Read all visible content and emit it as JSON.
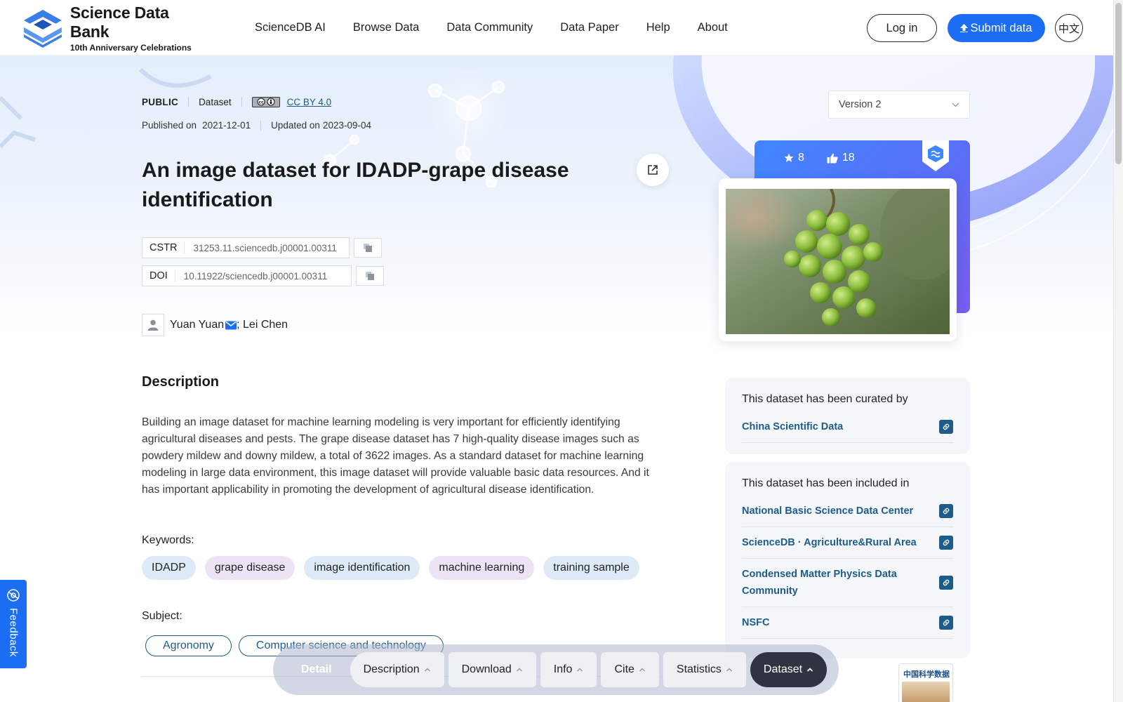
{
  "header": {
    "logo_title": "Science Data Bank",
    "logo_subtitle": "10th Anniversary Celebrations",
    "nav": [
      {
        "label": "ScienceDB AI"
      },
      {
        "label": "Browse Data"
      },
      {
        "label": "Data Community"
      },
      {
        "label": "Data Paper"
      },
      {
        "label": "Help"
      },
      {
        "label": "About"
      }
    ],
    "login_label": "Log in",
    "submit_label": "Submit data",
    "lang_label": "中文"
  },
  "meta": {
    "access": "PUBLIC",
    "type": "Dataset",
    "license": "CC BY 4.0",
    "published_label": "Published on",
    "published_date": "2021-12-01",
    "updated_label": "Updated on",
    "updated_date": "2023-09-04"
  },
  "dataset": {
    "title": "An image dataset for IDADP-grape disease identification",
    "cstr_label": "CSTR",
    "cstr_value": "31253.11.sciencedb.j00001.00311",
    "doi_label": "DOI",
    "doi_value": "10.11922/sciencedb.j00001.00311",
    "author1": "Yuan Yuan",
    "author_sep": "; ",
    "author2": "Lei Chen"
  },
  "description": {
    "heading": "Description",
    "text": "Building an image dataset for machine learning modeling is very important for efficiently identifying agricultural diseases and pests. The grape disease dataset has 7 high-quality disease images such as powdery mildew and downy mildew, a total of 3622 images. As a standard dataset for machine learning modeling in large data environment, this image dataset will provide valuable basic data resources. And it has important applicability in promoting the development of agricultural disease identification."
  },
  "keywords": {
    "label": "Keywords:",
    "items": [
      "IDADP",
      "grape disease",
      "image identification",
      "machine learning",
      "training sample"
    ]
  },
  "subject": {
    "label": "Subject:",
    "items": [
      "Agronomy",
      "Computer science and technology"
    ]
  },
  "sidebar": {
    "version": "Version 2",
    "stars": "8",
    "likes": "18",
    "curated_heading": "This dataset has been curated by",
    "curated": [
      {
        "label": "China Scientific Data"
      }
    ],
    "included_heading": "This dataset has been included in",
    "included": [
      {
        "label": "National Basic Science Data Center"
      },
      {
        "label": "ScienceDB · Agriculture&Rural Area"
      },
      {
        "label": "Condensed Matter Physics Data Community"
      },
      {
        "label": "NSFC"
      }
    ],
    "journal_thumb_text": "中国科学数据"
  },
  "feedback_label": "Feedback",
  "bottom_bar": {
    "detail": "Detail",
    "items": [
      {
        "label": "Description"
      },
      {
        "label": "Download"
      },
      {
        "label": "Info"
      },
      {
        "label": "Cite"
      },
      {
        "label": "Statistics"
      },
      {
        "label": "Dataset"
      }
    ]
  },
  "colors": {
    "accent": "#1b6ef3",
    "link": "#1d5c8a",
    "dark_tab": "#2f3440"
  }
}
